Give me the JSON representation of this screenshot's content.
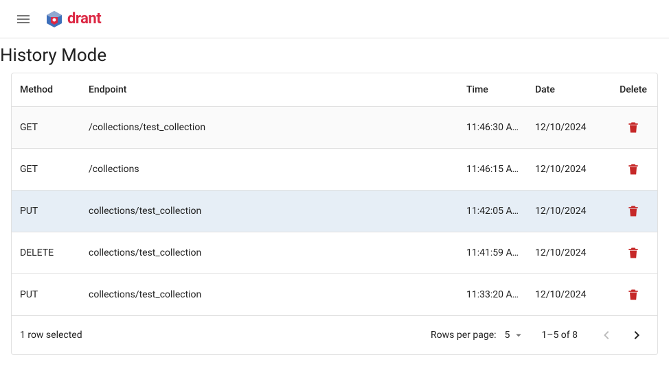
{
  "app": {
    "brand": "drant"
  },
  "page": {
    "title": "History Mode"
  },
  "table": {
    "headers": {
      "method": "Method",
      "endpoint": "Endpoint",
      "time": "Time",
      "date": "Date",
      "delete": "Delete"
    },
    "rows": [
      {
        "method": "GET",
        "endpoint": "/collections/test_collection",
        "time": "11:46:30 A…",
        "date": "12/10/2024",
        "selected": false,
        "striped": true
      },
      {
        "method": "GET",
        "endpoint": "/collections",
        "time": "11:46:15 A…",
        "date": "12/10/2024",
        "selected": false,
        "striped": false
      },
      {
        "method": "PUT",
        "endpoint": "collections/test_collection",
        "time": "11:42:05 A…",
        "date": "12/10/2024",
        "selected": true,
        "striped": false
      },
      {
        "method": "DELETE",
        "endpoint": "collections/test_collection",
        "time": "11:41:59 A…",
        "date": "12/10/2024",
        "selected": false,
        "striped": false
      },
      {
        "method": "PUT",
        "endpoint": "collections/test_collection",
        "time": "11:33:20 A…",
        "date": "12/10/2024",
        "selected": false,
        "striped": false
      }
    ]
  },
  "footer": {
    "selection": "1 row selected",
    "rows_per_page_label": "Rows per page:",
    "rows_per_page_value": "5",
    "range": "1–5 of 8"
  }
}
